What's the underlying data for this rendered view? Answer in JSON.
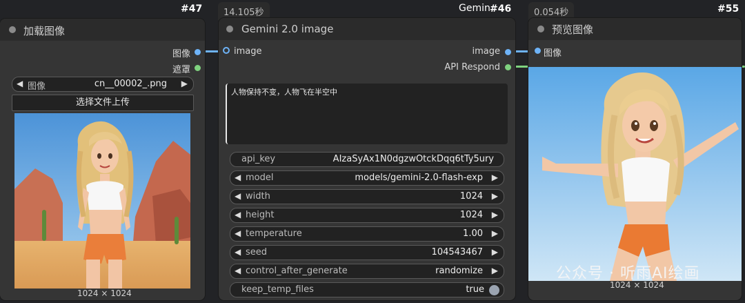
{
  "colors": {
    "canvas_bg": "#222326",
    "node_body": "#353535",
    "node_header": "#2b2b2b",
    "image_socket": "#6eb3f7",
    "string_socket": "#7fd27f"
  },
  "load_node": {
    "title": "加载图像",
    "id": "#47",
    "outputs": [
      "图像",
      "遮罩"
    ],
    "image_widget": {
      "label": "图像",
      "value": "cn__00002_.png"
    },
    "upload_label": "选择文件上传",
    "preview_caption": "1024 × 1024"
  },
  "gemini_node": {
    "exec_time": "14.105秒",
    "title": "Gemini 2.0 image",
    "id_prefix": "Gemin",
    "id": "#46",
    "input": "image",
    "outputs": [
      "image",
      "API Respond"
    ],
    "prompt_text": "人物保持不变，人物飞在半空中",
    "widgets": [
      {
        "label": "api_key",
        "value": "AIzaSyAx1N0dgzwOtckDqq6tTy5ury",
        "arrows": false
      },
      {
        "label": "model",
        "value": "models/gemini-2.0-flash-exp",
        "arrows": true
      },
      {
        "label": "width",
        "value": "1024",
        "arrows": true
      },
      {
        "label": "height",
        "value": "1024",
        "arrows": true
      },
      {
        "label": "temperature",
        "value": "1.00",
        "arrows": true
      },
      {
        "label": "seed",
        "value": "104543467",
        "arrows": true
      },
      {
        "label": "control_after_generate",
        "value": "randomize",
        "arrows": true
      },
      {
        "label": "keep_temp_files",
        "value": "true",
        "arrows": false,
        "toggle": true
      }
    ]
  },
  "preview_node": {
    "exec_time": "0.054秒",
    "title": "预览图像",
    "id": "#55",
    "input": "图像",
    "preview_caption": "1024 × 1024"
  },
  "watermark": "公众号 · 听雨AI绘画",
  "icons": {
    "arrow_left": "◀",
    "arrow_right": "▶"
  }
}
